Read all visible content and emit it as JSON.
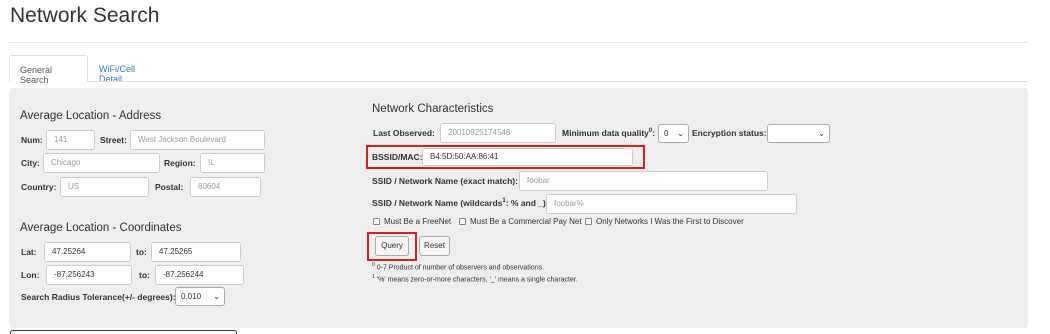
{
  "page": {
    "title": "Network Search"
  },
  "tabs": [
    {
      "label": "General Search",
      "active": true
    },
    {
      "label": "WiFi/Cell Detail",
      "active": false
    }
  ],
  "address": {
    "heading": "Average Location - Address",
    "num": {
      "label": "Num:",
      "placeholder": "141"
    },
    "street": {
      "label": "Street:",
      "placeholder": "West Jackson Boulevard"
    },
    "city": {
      "label": "City:",
      "placeholder": "Chicago"
    },
    "region": {
      "label": "Region:",
      "placeholder": "IL"
    },
    "country": {
      "label": "Country:",
      "placeholder": "US"
    },
    "postal": {
      "label": "Postal:",
      "placeholder": "60604"
    }
  },
  "coords": {
    "heading": "Average Location - Coordinates",
    "lat": {
      "label": "Lat:",
      "from": "47.25264",
      "to_label": "to:",
      "to": "47.25265"
    },
    "lon": {
      "label": "Lon:",
      "from": "-87.256243",
      "to_label": "to:",
      "to": "-87.256244"
    },
    "radius": {
      "label": "Search Radius Tolerance(+/- degrees):",
      "value": "0.010"
    }
  },
  "network": {
    "heading": "Network Characteristics",
    "last_observed": {
      "label": "Last Observed:",
      "placeholder": "20010925174546"
    },
    "min_quality": {
      "label": "Minimum data quality",
      "sup": "0",
      "colon": ":",
      "value": "0"
    },
    "encryption": {
      "label": "Encryption status:",
      "value": ""
    },
    "bssid": {
      "label": "BSSID/MAC:",
      "value": "B4:5D:50:AA:86:41"
    },
    "ssid_exact": {
      "label": "SSID / Network Name (exact match):",
      "placeholder": "foobar"
    },
    "ssid_wild": {
      "label_a": "SSID / Network Name (wildcards",
      "sup": "1",
      "label_b": ": % and _):",
      "placeholder": "foobar%"
    },
    "checkboxes": [
      {
        "label": "Must Be a FreeNet"
      },
      {
        "label": "Must Be a Commercial Pay Net"
      },
      {
        "label": "Only Networks I Was the First to Discover"
      }
    ],
    "query_label": "Query",
    "reset_label": "Reset",
    "footnote_0_mark": "0",
    "footnote_0": " 0-7 Product of number of observers and observations.",
    "footnote_1_mark": "1",
    "footnote_1": " '%' means zero-or-more characters, '_' means a single character."
  },
  "colors": {
    "highlight": "#d32020",
    "link": "#337ab7",
    "panel": "#eeeeee"
  }
}
